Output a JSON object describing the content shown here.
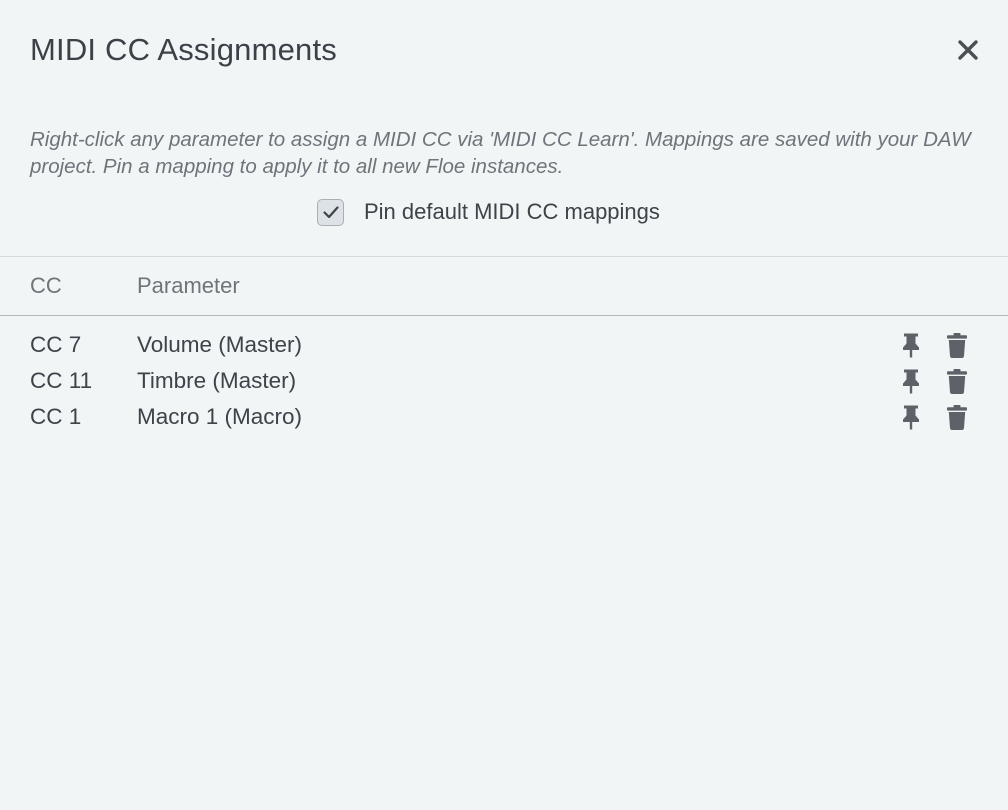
{
  "dialog": {
    "title": "MIDI CC Assignments",
    "close_icon": "close-icon",
    "description": "Right-click any parameter to assign a MIDI CC via 'MIDI CC Learn'. Mappings are saved with your DAW project. Pin a mapping to apply it to all new Floe instances.",
    "pin_default": {
      "label": "Pin default MIDI CC mappings",
      "checked": true
    }
  },
  "table": {
    "columns": [
      "CC",
      "Parameter"
    ],
    "rows": [
      {
        "cc": "CC 7",
        "parameter": "Volume (Master)"
      },
      {
        "cc": "CC 11",
        "parameter": "Timbre (Master)"
      },
      {
        "cc": "CC 1",
        "parameter": "Macro 1 (Macro)"
      }
    ],
    "row_icons": [
      "pin-icon",
      "trash-icon"
    ]
  },
  "colors": {
    "background": "#f2f5f6",
    "text": "#3d4349",
    "muted_text": "#6e747a",
    "icon": "#5c6268"
  }
}
